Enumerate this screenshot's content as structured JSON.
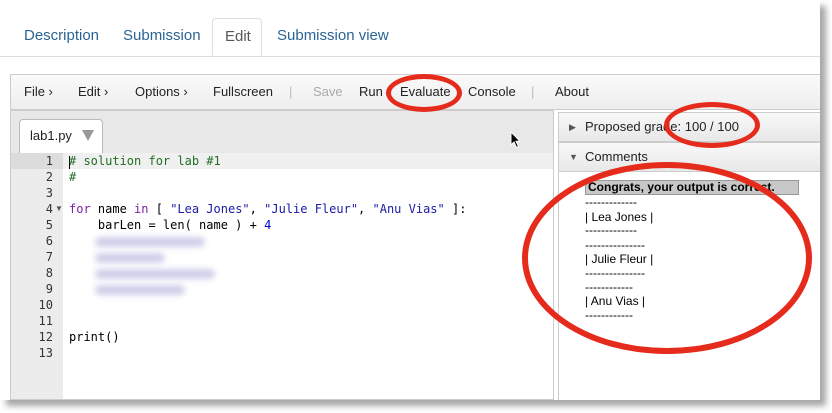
{
  "tabs": [
    {
      "label": "Description"
    },
    {
      "label": "Submission"
    },
    {
      "label": "Edit"
    },
    {
      "label": "Submission view"
    }
  ],
  "menu": {
    "file": "File ›",
    "edit": "Edit ›",
    "options": "Options ›",
    "fullscreen": "Fullscreen",
    "save": "Save",
    "run": "Run",
    "evaluate": "Evaluate",
    "console": "Console",
    "about": "About",
    "separator": "|"
  },
  "editor": {
    "file_tab": "lab1.py",
    "line_numbers": [
      "1",
      "2",
      "3",
      "4",
      "5",
      "6",
      "7",
      "8",
      "9",
      "10",
      "11",
      "12",
      "13"
    ],
    "lines": {
      "l1": "# solution for lab #1",
      "l2": "#",
      "l4_kw": "for",
      "l4_a": " name ",
      "l4_in": "in",
      "l4_b": " [ ",
      "l4_s1": "\"Lea Jones\"",
      "l4_c1": ", ",
      "l4_s2": "\"Julie Fleur\"",
      "l4_c2": ", ",
      "l4_s3": "\"Anu Vias\"",
      "l4_end": " ]:",
      "l5_a": "    barLen = len( name ) + ",
      "l5_num": "4",
      "l12": "print()"
    }
  },
  "right_pane": {
    "proposed_grade_label": "Proposed grade: 100 / 100",
    "comments_label": "Comments",
    "congrats": "Congrats, your output is correct.",
    "output": [
      "-------------",
      "| Lea Jones |",
      "-------------",
      "---------------",
      "| Julie Fleur |",
      "---------------",
      "------------",
      "| Anu Vias |",
      "------------"
    ]
  },
  "colors": {
    "annotation": "#e52b1c",
    "link": "#2a6496",
    "comment": "#236e24",
    "keyword": "#7a1fa8",
    "string": "#1a1aa6"
  },
  "icons": [
    "chevron-right-icon",
    "triangle-down-icon",
    "mouse-pointer-icon",
    "collapse-triangle-icon"
  ]
}
